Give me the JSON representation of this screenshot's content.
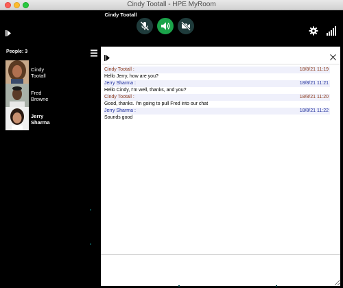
{
  "window": {
    "title": "Cindy Tootall - HPE MyRoom"
  },
  "call": {
    "caller_name": "Cindy Tootall"
  },
  "controls": {
    "mic_icon": "mic-muted-icon",
    "speaker_icon": "speaker-icon",
    "video_icon": "video-off-icon",
    "settings_icon": "gear-icon",
    "signal_icon": "signal-bars-icon",
    "accent_green": "#1ba34a",
    "control_bg": "#1f3b3b"
  },
  "people": {
    "header_label": "People: 3",
    "members": [
      {
        "name_line1": "Cindy",
        "name_line2": "Tootall",
        "active": false
      },
      {
        "name_line1": "Fred",
        "name_line2": "Browne",
        "active": false
      },
      {
        "name_line1": "Jerry",
        "name_line2": "Sharma",
        "active": true
      }
    ]
  },
  "chat": {
    "messages": [
      {
        "author": "Cindy Tootall :",
        "time": "18/8/21 11:19",
        "text": "Hello Jerry, how are you?",
        "color": "#8b3a1a"
      },
      {
        "author": "Jerry Sharma :",
        "time": "18/8/21 11:21",
        "text": "Hello Cindy, I'm well, thanks, and you?",
        "color": "#1a2a9a"
      },
      {
        "author": "Cindy Tootall :",
        "time": "18/8/21 11:20",
        "text": "Good, thanks. I'm going to pull Fred into our chat",
        "color": "#8b3a1a"
      },
      {
        "author": "Jerry Sharma :",
        "time": "18/8/21 11:22",
        "text": "Sounds good",
        "color": "#1a2a9a"
      }
    ],
    "input_value": ""
  }
}
